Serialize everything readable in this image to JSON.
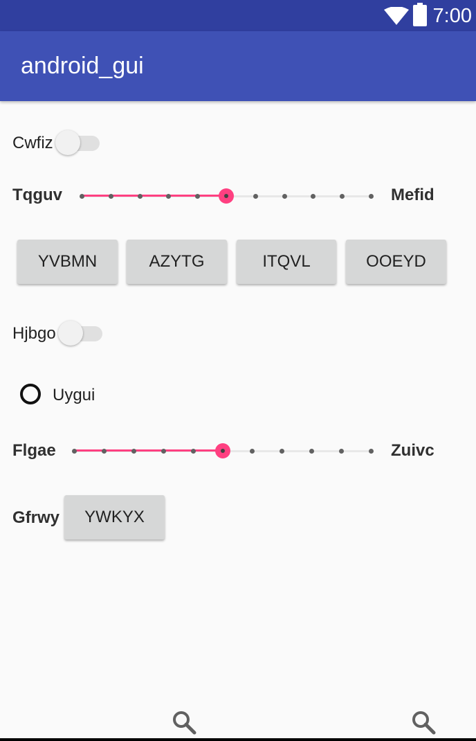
{
  "status_bar": {
    "time": "7:00",
    "wifi_icon": "wifi-icon",
    "battery_icon": "battery-icon"
  },
  "app_bar": {
    "title": "android_gui"
  },
  "switch1": {
    "label": "Cwfiz",
    "checked": false
  },
  "slider1": {
    "left_label": "Tqguv",
    "right_label": "Mefid",
    "value": 5,
    "max": 10
  },
  "buttons_row": [
    "YVBMN",
    "AZYTG",
    "ITQVL",
    "OOEYD"
  ],
  "switch2": {
    "label": "Hjbgo",
    "checked": false
  },
  "radio": {
    "label": "Uygui",
    "checked": false
  },
  "slider2": {
    "left_label": "Flgae",
    "right_label": "Zuivc",
    "value": 5,
    "max": 10
  },
  "row_last": {
    "label": "Gfrwy",
    "button": "YWKYX"
  },
  "colors": {
    "primary": "#3f51b5",
    "primary_dark": "#303f9f",
    "accent": "#ff4081"
  },
  "bottom_icons": [
    "search-icon",
    "search-icon"
  ]
}
